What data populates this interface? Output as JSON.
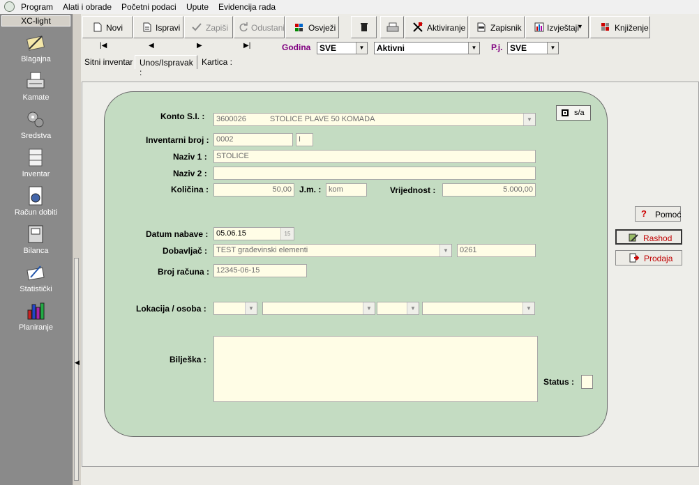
{
  "menubar": {
    "items": [
      "Program",
      "Alati i obrade",
      "Početni podaci",
      "Upute",
      "Evidencija rada"
    ]
  },
  "sidebar": {
    "title": "XC-light",
    "items": [
      {
        "label": "Blagajna",
        "icon": "pen-paper-icon"
      },
      {
        "label": "Kamate",
        "icon": "typewriter-icon"
      },
      {
        "label": "Sredstva",
        "icon": "gears-icon"
      },
      {
        "label": "Inventar",
        "icon": "cabinet-icon"
      },
      {
        "label": "Račun dobiti",
        "icon": "document-chart-icon"
      },
      {
        "label": "Bilanca",
        "icon": "binder-icon"
      },
      {
        "label": "Statistički",
        "icon": "drawing-icon"
      },
      {
        "label": "Planiranje",
        "icon": "bar-chart-icon"
      }
    ]
  },
  "toolbar": {
    "novi": "Novi",
    "ispravi": "Ispravi",
    "zapisi": "Zapiši",
    "odustani": "Odustani",
    "osvjezi": "Osvježi",
    "aktiviranje": "Aktiviranje",
    "zapisnik": "Zapisnik",
    "izvjestaji": "Izvještaji",
    "knjizenje": "Knjiženje"
  },
  "nav": {
    "first": "|◀",
    "prev": "◀",
    "next": "▶",
    "last": "▶|",
    "godina_label": "Godina",
    "godina_value": "SVE",
    "status_value": "Aktivni",
    "pj_label": "P.j.",
    "pj_value": "SVE"
  },
  "tabs": [
    "Sitni inventar :",
    "Unos/Ispravak :",
    "Kartica :"
  ],
  "form": {
    "konto_label": "Konto S.I. :",
    "konto_code": "3600026",
    "konto_name": "STOLICE PLAVE 50 KOMADA",
    "sa_button": "s/a",
    "inv_label": "Inventarni broj :",
    "inv_value": "0002",
    "inv_suffix": "I",
    "naziv1_label": "Naziv 1 :",
    "naziv1_value": "STOLICE",
    "naziv2_label": "Naziv 2 :",
    "naziv2_value": "",
    "kolicina_label": "Količina :",
    "kolicina_value": "50,00",
    "jm_label": "J.m. :",
    "jm_value": "kom",
    "vrijednost_label": "Vrijednost :",
    "vrijednost_value": "5.000,00",
    "datum_label": "Datum nabave :",
    "datum_value": "05.06.15",
    "dobavljac_label": "Dobavljač :",
    "dobavljac_value": "TEST građevinski elementi",
    "dobavljac_code": "0261",
    "racun_label": "Broj računa :",
    "racun_value": "12345-06-15",
    "lokacija_label": "Lokacija / osoba :",
    "biljeska_label": "Bilješka :",
    "status_label": "Status :"
  },
  "side_buttons": {
    "pomoc": "Pomoć",
    "rashod": "Rashod",
    "prodaja": "Prodaja"
  },
  "colors": {
    "panel_green": "#c4dcc2",
    "field_bg": "#fffde6",
    "accent_red": "#c00000",
    "label_purple": "#800080",
    "sidebar_bg": "#8a8a8a"
  }
}
